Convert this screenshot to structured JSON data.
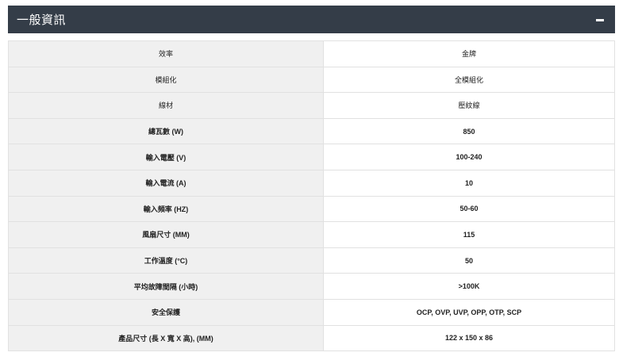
{
  "panel": {
    "title": "一般資訊"
  },
  "rows": [
    {
      "label": "效率",
      "value": "金牌"
    },
    {
      "label": "模組化",
      "value": "全模組化"
    },
    {
      "label": "線材",
      "value": "壓紋線"
    },
    {
      "label": "總瓦數 (W)",
      "value": "850"
    },
    {
      "label": "輸入電壓 (V)",
      "value": "100-240"
    },
    {
      "label": "輸入電流 (A)",
      "value": "10"
    },
    {
      "label": "輸入頻率 (HZ)",
      "value": "50-60"
    },
    {
      "label": "風扇尺寸 (MM)",
      "value": "115"
    },
    {
      "label": "工作溫度 (°C)",
      "value": "50"
    },
    {
      "label": "平均故障間隔 (小時)",
      "value": ">100K"
    },
    {
      "label": "安全保護",
      "value": "OCP, OVP, UVP, OPP, OTP, SCP"
    },
    {
      "label": "產品尺寸 (長 X 寬 X 高), (MM)",
      "value": "122 x 150 x 86"
    }
  ]
}
